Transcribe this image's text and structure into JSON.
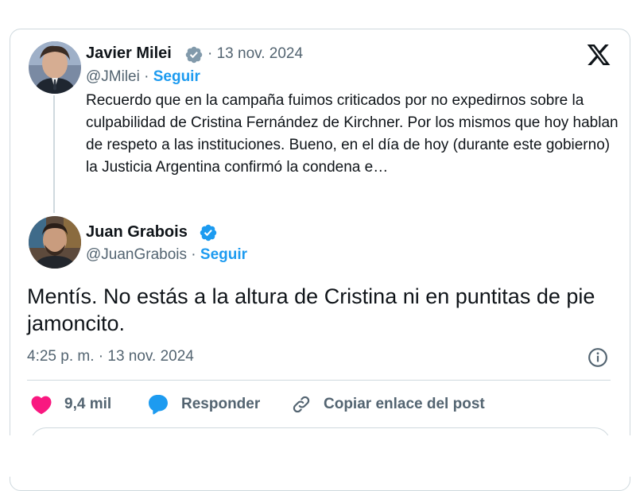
{
  "quoted": {
    "author": "Javier Milei",
    "date": "· 13 nov. 2024",
    "handle": "@JMilei ·",
    "follow": "Seguir",
    "text": "Recuerdo que en la campaña fuimos criticados por no expedirnos sobre la culpabilidad de Cristina Fernández de Kirchner. Por los mismos que hoy hablan de respeto a las instituciones. Bueno, en el día de hoy (durante este gobierno) la Justicia Argentina confirmó la condena e…"
  },
  "reply": {
    "author": "Juan Grabois",
    "handle": "@JuanGrabois ·",
    "follow": "Seguir",
    "text": "Mentís. No estás a la altura de Cristina ni en puntitas de pie jamoncito.",
    "timestamp": "4:25 p. m. · 13 nov. 2024"
  },
  "actions": {
    "likes": "9,4 mil",
    "reply": "Responder",
    "copy_link": "Copiar enlace del post"
  },
  "colors": {
    "accent": "#1d9bf0",
    "like": "#f91880",
    "muted": "#536471",
    "border": "#cfd9de"
  },
  "icons": [
    "x-logo-icon",
    "verified-badge-icon",
    "info-icon",
    "heart-icon",
    "reply-bubble-icon",
    "link-icon"
  ]
}
